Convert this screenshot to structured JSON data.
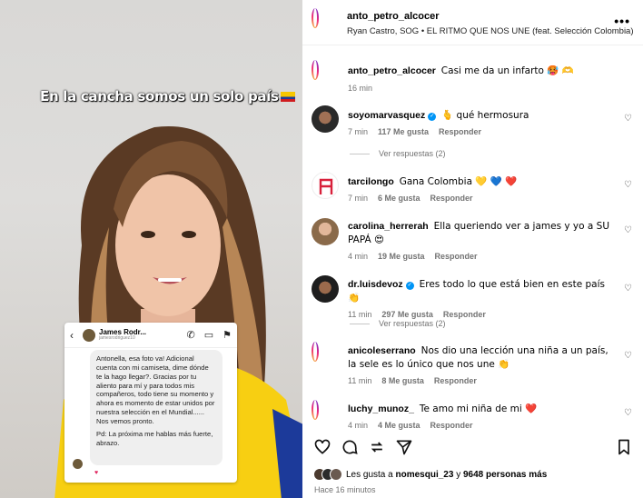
{
  "video": {
    "caption": "En la cancha somos un solo país",
    "dm": {
      "name": "James Rodr...",
      "handle": "jamesrodriguez10",
      "message_1": "Antonella, esa foto va! Adicional cuenta con mi camiseta, dime dónde te la hago llegar?. Gracias por tu aliento para mí y para todos mis compañeros, todo tiene su momento y ahora es momento de estar unidos por nuestra selección en el Mundial...... Nos vemos pronto.",
      "message_2": "Pd: La próxima me hablas más fuerte, abrazo.",
      "reaction": "♥"
    }
  },
  "header": {
    "username": "anto_petro_alcocer",
    "audio": "Ryan Castro, SOG • EL RITMO QUE NOS UNE (feat. Selección Colombia)",
    "more": "•••"
  },
  "caption_comment": {
    "username": "anto_petro_alcocer",
    "text": "Casi me da un infarto 🥵 🫶",
    "time": "16 min"
  },
  "comments": [
    {
      "username": "soyomarvasquez",
      "verified": true,
      "text": "🫰 qué hermosura",
      "time": "7 min",
      "likes": "117 Me gusta",
      "reply": "Responder",
      "view_replies": "Ver respuestas (2)"
    },
    {
      "username": "tarcilongo",
      "verified": false,
      "text": "Gana Colombia 💛 💙 ❤️",
      "time": "7 min",
      "likes": "6 Me gusta",
      "reply": "Responder"
    },
    {
      "username": "carolina_herrerah",
      "verified": false,
      "text": "Ella queriendo ver a james y yo a SU PAPÁ 😍",
      "time": "4 min",
      "likes": "19 Me gusta",
      "reply": "Responder"
    },
    {
      "username": "dr.luisdevoz",
      "verified": true,
      "text": "Eres todo lo que está bien en este país 👏",
      "time": "11 min",
      "likes": "297 Me gusta",
      "reply": "Responder",
      "view_replies": "Ver respuestas (2)"
    },
    {
      "username": "anicoleserrano",
      "verified": false,
      "text": "Nos dio una lección una niña a un país, la sele es lo único que nos une 👏",
      "time": "11 min",
      "likes": "8 Me gusta",
      "reply": "Responder"
    },
    {
      "username": "luchy_munoz_",
      "verified": false,
      "text": "Te amo mi niña de mi ❤️",
      "time": "4 min",
      "likes": "4 Me gusta",
      "reply": "Responder"
    }
  ],
  "footer": {
    "likes_prefix": "Les gusta a",
    "likes_user": "nomesqui_23",
    "likes_mid": "y",
    "likes_count": "9648 personas más",
    "time_ago": "Hace 16 minutos"
  },
  "icons": [
    "heart-icon",
    "comment-icon",
    "share-icon",
    "send-icon",
    "bookmark-icon"
  ],
  "colors": {
    "verified": "#0095f6",
    "muted": "#737373",
    "like_heart": "#e0245e"
  }
}
